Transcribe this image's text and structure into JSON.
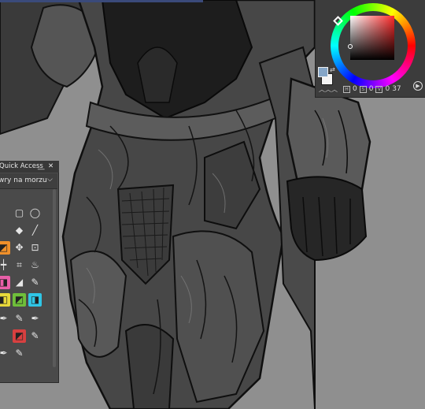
{
  "color_panel": {
    "hue_color": "#ff2a2a",
    "foreground_color": "#85a6c8",
    "background_color": "#f4f4f4",
    "values": [
      "0",
      "0",
      "0",
      "37"
    ],
    "icons": [
      "swap-colors-icon",
      "transparency-icon",
      "play-icon"
    ]
  },
  "quick_access": {
    "title": "Quick Access",
    "minimize_glyph": "__",
    "close_glyph": "✕",
    "dropdown_value": "wry na morzu",
    "dropdown_chevron": "⌵",
    "tools": [
      {
        "name": "square-tool-icon",
        "glyph": "▢"
      },
      {
        "name": "eraser-icon",
        "glyph": "◆"
      },
      {
        "name": "lasso-icon",
        "glyph": "◯"
      },
      {
        "name": "line-icon",
        "glyph": "╱"
      },
      {
        "name": "orange-fill-icon",
        "glyph": "◩"
      },
      {
        "name": "move-icon",
        "glyph": "✥"
      },
      {
        "name": "frame-icon",
        "glyph": "⊡"
      },
      {
        "name": "ruler-icon",
        "glyph": "┿"
      },
      {
        "name": "transform-icon",
        "glyph": "⌗"
      },
      {
        "name": "blend-icon",
        "glyph": "♨"
      },
      {
        "name": "pink-brush-icon",
        "glyph": "◨"
      },
      {
        "name": "marker-icon",
        "glyph": "◢"
      },
      {
        "name": "pen-icon",
        "glyph": "✎"
      },
      {
        "name": "yellow-tool-icon",
        "glyph": "◧"
      },
      {
        "name": "green-tool-icon",
        "glyph": "◩"
      },
      {
        "name": "cyan-tool-icon",
        "glyph": "◨"
      },
      {
        "name": "ink-pen-icon",
        "glyph": "✒"
      },
      {
        "name": "pencil-icon",
        "glyph": "✎"
      },
      {
        "name": "nib-icon",
        "glyph": "✒"
      },
      {
        "name": "red-brush-icon",
        "glyph": "◩"
      },
      {
        "name": "brush-icon",
        "glyph": "✎"
      },
      {
        "name": "pen-2-icon",
        "glyph": "✒"
      },
      {
        "name": "pen-3-icon",
        "glyph": "✎"
      }
    ]
  },
  "accent_colors": {
    "orange": "#f0902a",
    "pink": "#e85fa8",
    "yellow": "#e8d83a",
    "green": "#6fbf3a",
    "cyan": "#2fc6e6",
    "red": "#d84040"
  }
}
